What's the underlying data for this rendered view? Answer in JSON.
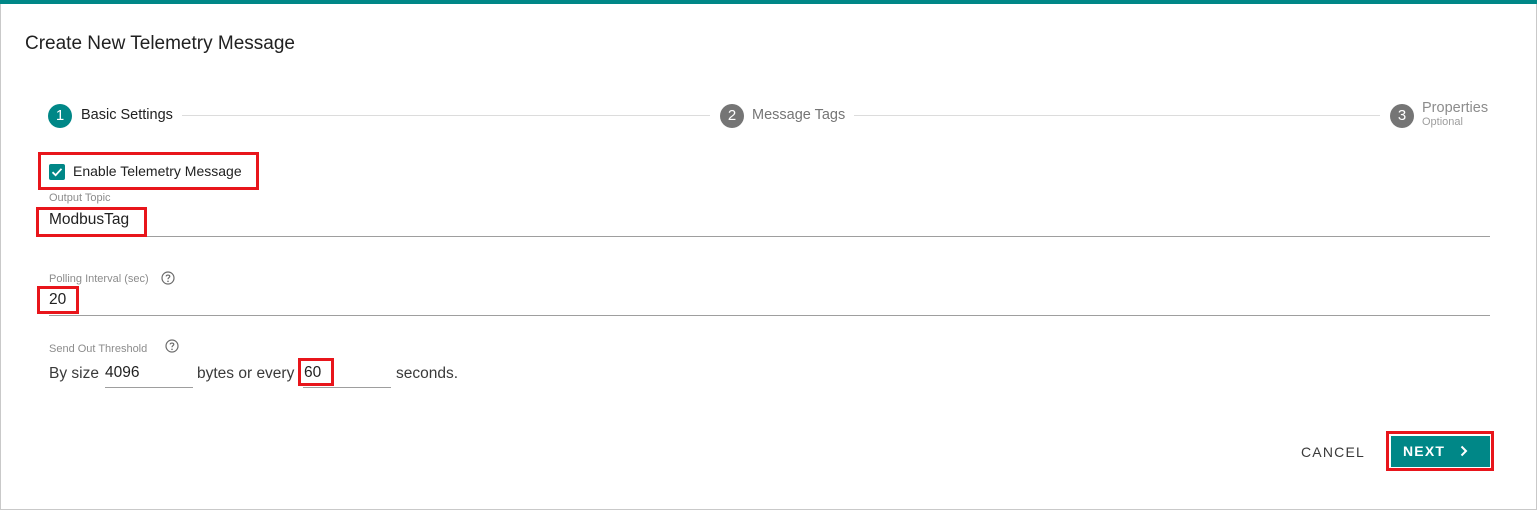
{
  "dialog": {
    "title": "Create New Telemetry Message",
    "accent_color": "#008787",
    "highlight_color": "#e8151b"
  },
  "stepper": {
    "steps": [
      {
        "number": "1",
        "label": "Basic Settings",
        "sublabel": "",
        "state": "active"
      },
      {
        "number": "2",
        "label": "Message Tags",
        "sublabel": "",
        "state": "inactive"
      },
      {
        "number": "3",
        "label": "Properties",
        "sublabel": "Optional",
        "state": "inactive"
      }
    ]
  },
  "form": {
    "enable_checkbox": {
      "label": "Enable Telemetry Message",
      "checked": true
    },
    "output_topic": {
      "label": "Output Topic",
      "value": "ModbusTag"
    },
    "polling_interval": {
      "label": "Polling Interval (sec)",
      "value": "20"
    },
    "send_out_threshold": {
      "label": "Send Out Threshold",
      "prefix": "By size",
      "size_value": "4096",
      "middle": "bytes or every",
      "seconds_value": "60",
      "suffix": "seconds."
    }
  },
  "actions": {
    "cancel_label": "CANCEL",
    "next_label": "NEXT"
  }
}
